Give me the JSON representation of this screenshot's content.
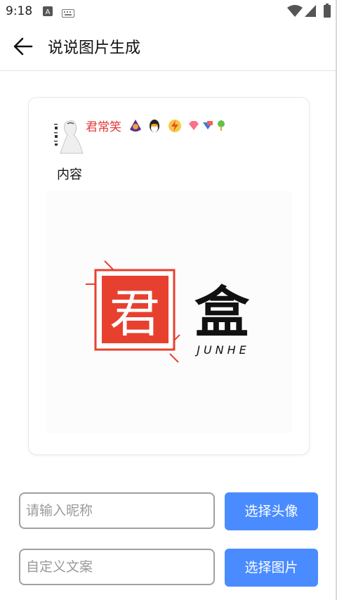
{
  "status_bar": {
    "time": "9:18",
    "icons": [
      "font-a-icon",
      "keyboard-icon",
      "wifi-icon",
      "signal-icon",
      "battery-icon"
    ]
  },
  "app_bar": {
    "back_icon": "arrow-left-icon",
    "title": "说说图片生成"
  },
  "preview": {
    "nickname": "君常笑",
    "badges": [
      "qq-badge-purple",
      "qq-penguin-badge",
      "lightning-badge",
      "gem-badge",
      "vip-badge",
      "plant-badge"
    ],
    "content": "内容",
    "logo": {
      "seal_char": "君",
      "char": "盒",
      "latin": "JUNHE"
    }
  },
  "form": {
    "nickname_input": {
      "value": "",
      "placeholder": "请输入昵称"
    },
    "choose_avatar_label": "选择头像",
    "text_input": {
      "value": "",
      "placeholder": "自定义文案"
    },
    "choose_image_label": "选择图片"
  },
  "colors": {
    "accent_blue": "#4a8cff",
    "nickname_red": "#e53935",
    "seal_red": "#e8402f"
  }
}
